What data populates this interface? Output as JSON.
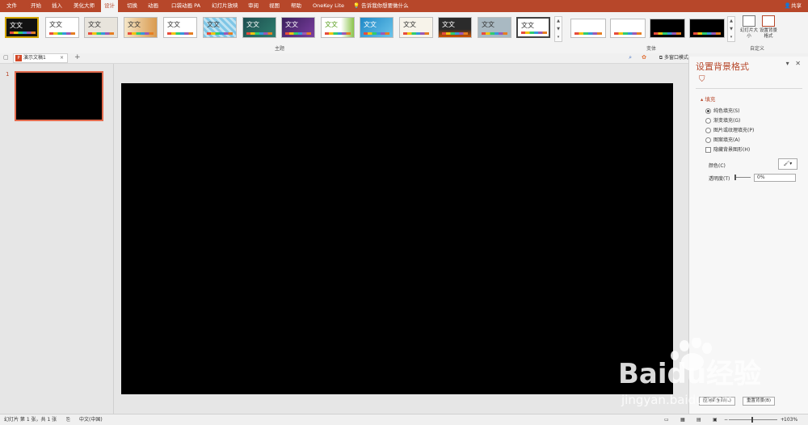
{
  "tabs": [
    "文件",
    "开始",
    "插入",
    "美化大师",
    "设计",
    "切换",
    "动画",
    "口袋动画 PA",
    "幻灯片放映",
    "审阅",
    "视图",
    "帮助",
    "OneKey Lite"
  ],
  "active_tab_index": 4,
  "tell_me": "告诉我你想要做什么",
  "share": "共享",
  "theme_sample": "文文",
  "groups": {
    "themes": "主题",
    "variants": "变体",
    "customize": "自定义"
  },
  "customize_buttons": {
    "slide_size": "幻灯片大小",
    "format_background": "设置背景格式"
  },
  "doc_tab": {
    "name": "演示文稿1",
    "badge": "P",
    "close": "×"
  },
  "new_tab": "+",
  "multi_window": "多窗口模式",
  "slide_number": "1",
  "pane": {
    "title": "设置背景格式",
    "section": "填充",
    "options": [
      "纯色填充(S)",
      "渐变填充(G)",
      "图片或纹理填充(P)",
      "图案填充(A)"
    ],
    "hide_graphics": "隐藏背景图形(H)",
    "color_label": "颜色(C)",
    "transparency_label": "透明度(T)",
    "transparency_value": "0%",
    "apply_all": "应用到全部(L)",
    "reset": "重置背景(B)"
  },
  "status": {
    "slide_info": "幻灯片 第 1 张，共 1 张",
    "language": "中文(中国)",
    "zoom": "103%"
  },
  "watermark": {
    "brand": "Baidu经验",
    "url": "jingyan.baidu.com"
  },
  "colors": {
    "accent": "#b7472a",
    "slide_bg": "#000000"
  }
}
